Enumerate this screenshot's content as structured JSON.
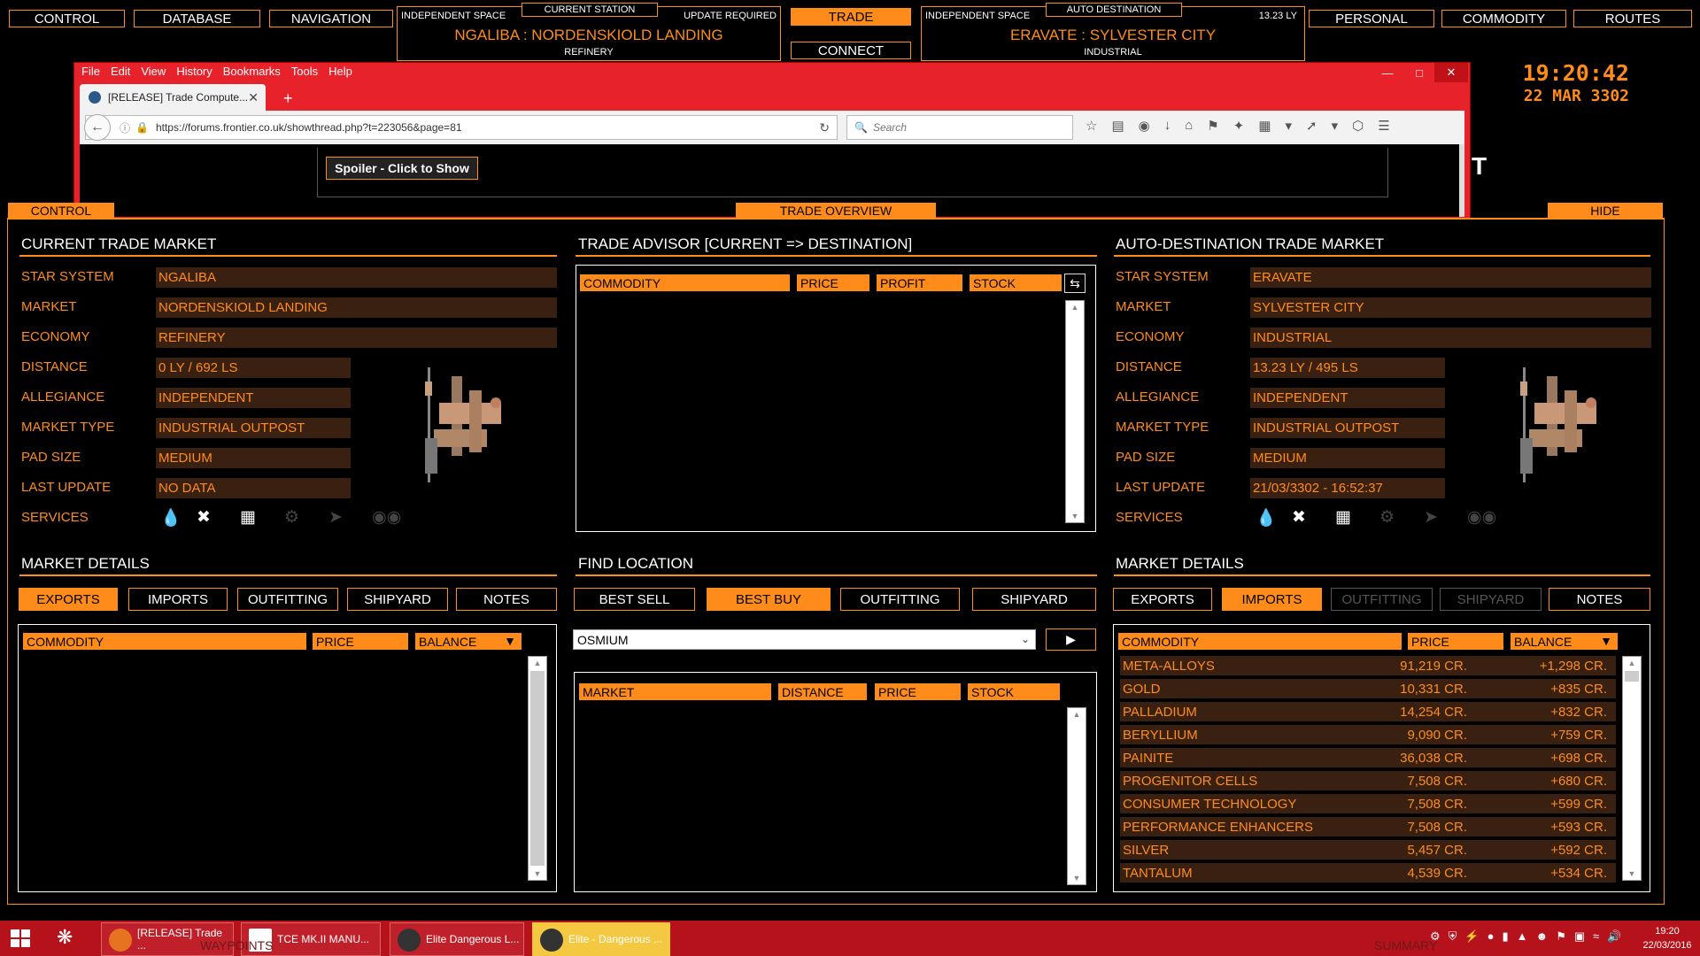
{
  "topnav": {
    "control": "CONTROL",
    "database": "DATABASE",
    "navigation": "NAVIGATION",
    "trade": "TRADE",
    "connect": "CONNECT",
    "personal": "PERSONAL",
    "commodity": "COMMODITY",
    "routes": "ROUTES"
  },
  "current_station": {
    "tag": "CURRENT STATION",
    "space": "INDEPENDENT SPACE",
    "status": "UPDATE REQUIRED",
    "name": "NGALIBA : NORDENSKIOLD LANDING",
    "economy": "REFINERY"
  },
  "auto_destination": {
    "tag": "AUTO DESTINATION",
    "space": "INDEPENDENT SPACE",
    "distance": "13.23 LY",
    "name": "ERAVATE : SYLVESTER CITY",
    "economy": "INDUSTRIAL"
  },
  "clock": {
    "time": "19:20:42",
    "date": "22 MAR 3302"
  },
  "overlay_text": "T",
  "browser": {
    "menu": [
      "File",
      "Edit",
      "View",
      "History",
      "Bookmarks",
      "Tools",
      "Help"
    ],
    "tab_title": "[RELEASE] Trade Compute...",
    "new_tab": "+",
    "url": "https://forums.frontier.co.uk/showthread.php?t=223056&page=81",
    "search_placeholder": "Search",
    "spoiler": "Spoiler - Click to Show"
  },
  "panel": {
    "control_tab": "CONTROL",
    "title": "TRADE OVERVIEW",
    "hide_tab": "HIDE"
  },
  "current_market": {
    "title": "CURRENT TRADE MARKET",
    "labels": [
      "STAR SYSTEM",
      "MARKET",
      "ECONOMY",
      "DISTANCE",
      "ALLEGIANCE",
      "MARKET TYPE",
      "PAD SIZE",
      "LAST UPDATE",
      "SERVICES"
    ],
    "star_system": "NGALIBA",
    "market": "NORDENSKIOLD LANDING",
    "economy": "REFINERY",
    "distance": "0 LY / 692 LS",
    "allegiance": "INDEPENDENT",
    "market_type": "INDUSTRIAL OUTPOST",
    "pad_size": "MEDIUM",
    "last_update": "NO DATA"
  },
  "dest_market": {
    "title": "AUTO-DESTINATION TRADE MARKET",
    "labels": [
      "STAR SYSTEM",
      "MARKET",
      "ECONOMY",
      "DISTANCE",
      "ALLEGIANCE",
      "MARKET TYPE",
      "PAD SIZE",
      "LAST UPDATE",
      "SERVICES"
    ],
    "star_system": "ERAVATE",
    "market": "SYLVESTER CITY",
    "economy": "INDUSTRIAL",
    "distance": "13.23 LY / 495 LS",
    "allegiance": "INDEPENDENT",
    "market_type": "INDUSTRIAL OUTPOST",
    "pad_size": "MEDIUM",
    "last_update": "21/03/3302 - 16:52:37"
  },
  "trade_advisor": {
    "title": "TRADE ADVISOR [CURRENT => DESTINATION]",
    "headers": [
      "COMMODITY",
      "PRICE",
      "PROFIT",
      "STOCK"
    ]
  },
  "market_details_left": {
    "title": "MARKET DETAILS",
    "tabs": [
      "EXPORTS",
      "IMPORTS",
      "OUTFITTING",
      "SHIPYARD",
      "NOTES"
    ],
    "headers": [
      "COMMODITY",
      "PRICE",
      "BALANCE"
    ]
  },
  "find_location": {
    "title": "FIND LOCATION",
    "tabs": [
      "BEST SELL",
      "BEST BUY",
      "OUTFITTING",
      "SHIPYARD"
    ],
    "selected_commodity": "OSMIUM",
    "headers": [
      "MARKET",
      "DISTANCE",
      "PRICE",
      "STOCK"
    ]
  },
  "market_details_right": {
    "title": "MARKET DETAILS",
    "tabs": [
      "EXPORTS",
      "IMPORTS",
      "OUTFITTING",
      "SHIPYARD",
      "NOTES"
    ],
    "headers": [
      "COMMODITY",
      "PRICE",
      "BALANCE"
    ],
    "rows": [
      {
        "commodity": "META-ALLOYS",
        "price": "91,219 CR.",
        "balance": "+1,298 CR."
      },
      {
        "commodity": "GOLD",
        "price": "10,331 CR.",
        "balance": "+835 CR."
      },
      {
        "commodity": "PALLADIUM",
        "price": "14,254 CR.",
        "balance": "+832 CR."
      },
      {
        "commodity": "BERYLLIUM",
        "price": "9,090 CR.",
        "balance": "+759 CR."
      },
      {
        "commodity": "PAINITE",
        "price": "36,038 CR.",
        "balance": "+698 CR."
      },
      {
        "commodity": "PROGENITOR CELLS",
        "price": "7,508 CR.",
        "balance": "+680 CR."
      },
      {
        "commodity": "CONSUMER TECHNOLOGY",
        "price": "7,508 CR.",
        "balance": "+599 CR."
      },
      {
        "commodity": "PERFORMANCE ENHANCERS",
        "price": "7,508 CR.",
        "balance": "+593 CR."
      },
      {
        "commodity": "SILVER",
        "price": "5,457 CR.",
        "balance": "+592 CR."
      },
      {
        "commodity": "TANTALUM",
        "price": "4,539 CR.",
        "balance": "+534 CR."
      }
    ]
  },
  "taskbar": {
    "items": [
      "[RELEASE] Trade ...",
      "TCE MK.II MANU...",
      "Elite Dangerous L...",
      "Elite - Dangerous ..."
    ],
    "time": "19:20",
    "date": "22/03/2016",
    "ghost_left": "WAYPOINTS",
    "ghost_right": "SUMMARY"
  },
  "colors": {
    "accent": "#ff8c1a",
    "field_bg": "#3a2010",
    "taskbar": "#b5121b"
  }
}
